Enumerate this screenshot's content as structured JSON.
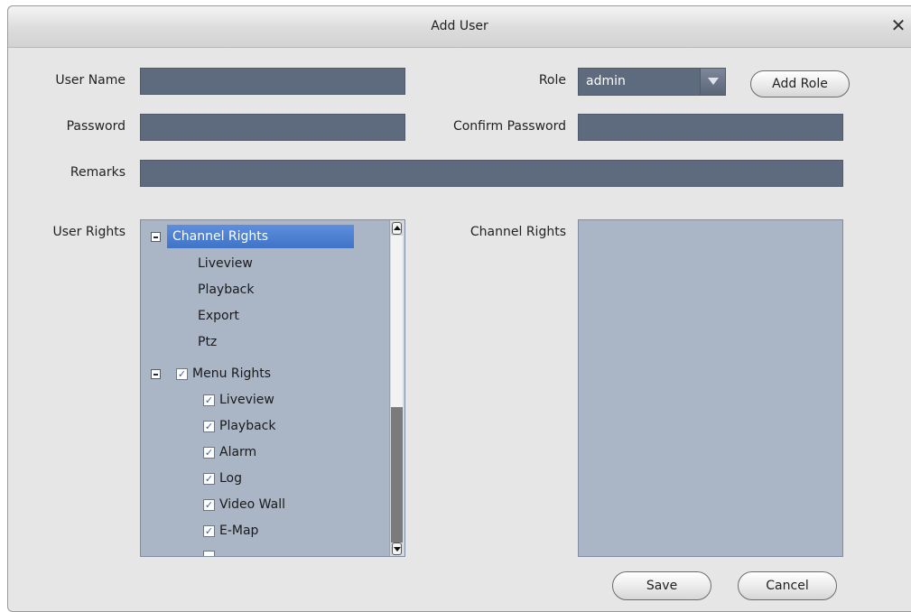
{
  "dialog": {
    "title": "Add User",
    "close_symbol": "✕"
  },
  "form": {
    "user_name_label": "User Name",
    "user_name_value": "",
    "password_label": "Password",
    "password_value": "",
    "remarks_label": "Remarks",
    "remarks_value": "",
    "role_label": "Role",
    "role_value": "admin",
    "add_role_label": "Add Role",
    "confirm_password_label": "Confirm Password",
    "confirm_password_value": "",
    "user_rights_label": "User Rights",
    "channel_rights_label": "Channel Rights"
  },
  "tree": {
    "channel_rights": {
      "label": "Channel Rights",
      "children": [
        "Liveview",
        "Playback",
        "Export",
        "Ptz"
      ]
    },
    "menu_rights": {
      "label": "Menu Rights",
      "checked": true,
      "children": [
        {
          "label": "Liveview",
          "checked": true
        },
        {
          "label": "Playback",
          "checked": true
        },
        {
          "label": "Alarm",
          "checked": true
        },
        {
          "label": "Log",
          "checked": true
        },
        {
          "label": "Video Wall",
          "checked": true
        },
        {
          "label": "E-Map",
          "checked": true
        }
      ]
    }
  },
  "buttons": {
    "save": "Save",
    "cancel": "Cancel"
  },
  "check_glyph": "✓",
  "colors": {
    "field_bg": "#5e6a7d",
    "panel_bg": "#aab5c6",
    "highlight": "#4a7fd2",
    "dialog_bg": "#e6e6e6"
  }
}
